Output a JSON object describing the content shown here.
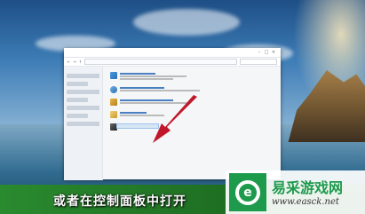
{
  "subtitle": "或者在控制面板中打开",
  "watermark": {
    "name": "易采游戏网",
    "url": "www.easck.net"
  },
  "colors": {
    "accent": "#c0182a",
    "watermark_green": "#1d9a4c",
    "taskbar_green": "#2a8a2e"
  },
  "icons": [
    "red-arrow-icon",
    "watermark-logo-icon"
  ]
}
